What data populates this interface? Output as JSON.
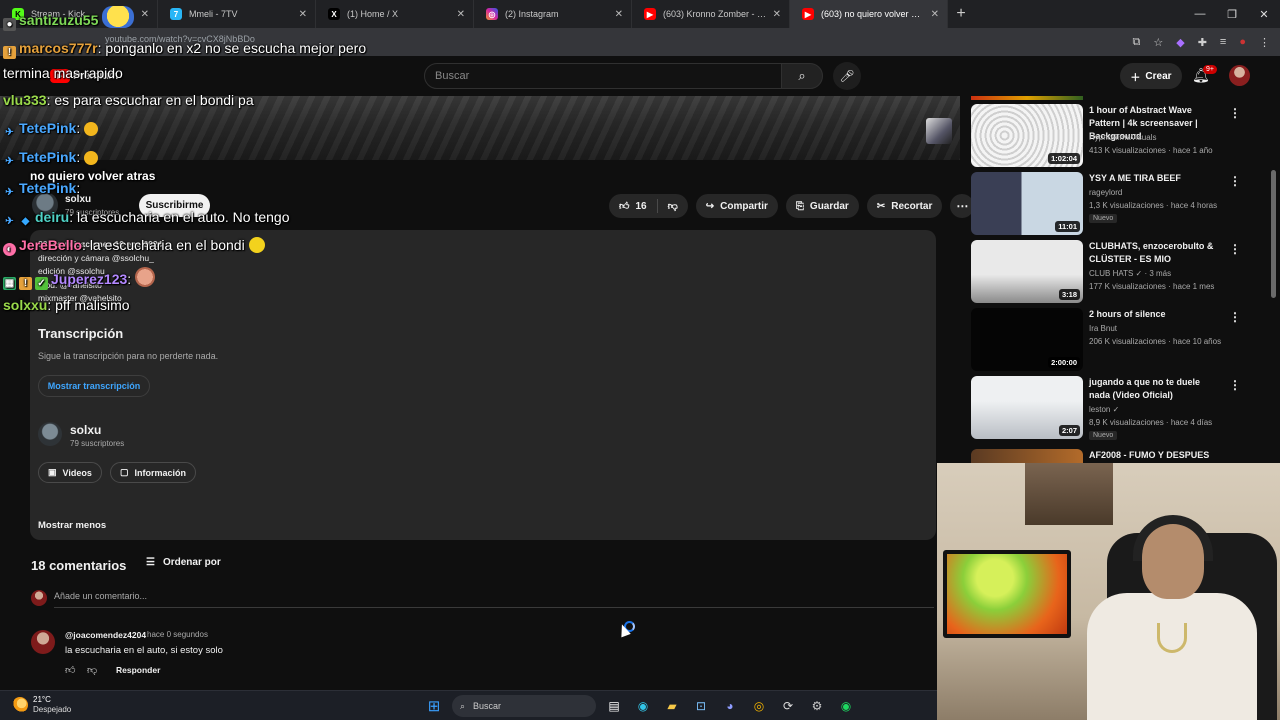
{
  "browser": {
    "tabs": [
      {
        "label": "Stream - Kick",
        "icon": "kick-icon",
        "color": "#53fc18",
        "active": false
      },
      {
        "label": "Mmeli - 7TV",
        "icon": "7tv-icon",
        "color": "#29b6f6",
        "active": false
      },
      {
        "label": "(1) Home / X",
        "icon": "x-icon",
        "color": "#000000",
        "active": false
      },
      {
        "label": "(2) Instagram",
        "icon": "instagram-icon",
        "color": "#d6249f",
        "active": false
      },
      {
        "label": "(603) Kronno Zomber - Chica g",
        "icon": "youtube-icon",
        "color": "#ff0000",
        "active": false
      },
      {
        "label": "(603) no quiero volver atras - Y",
        "icon": "youtube-icon",
        "color": "#ff0000",
        "active": true
      }
    ],
    "url": "youtube.com/watch?v=cvCX8jNbBDo"
  },
  "youtube": {
    "brand": "Premium",
    "search_placeholder": "Buscar",
    "create_label": "Crear",
    "notifications": "9+"
  },
  "video": {
    "title_partial": "no quiero volver atras",
    "channel": "solxu",
    "subscribers_partial": "79 suscriptores",
    "subscribe_label": "Suscribirme",
    "likes": "16",
    "share_label": "Compartir",
    "save_label": "Guardar",
    "clip_label": "Recortar"
  },
  "description": {
    "meta": "82 visualizaciones  10 ene 2024",
    "lines": [
      "dirección y cámara @ssolchu_",
      "edición @ssolchu_",
      "prod. @vanelsito",
      "mixmaster @vahelsito"
    ],
    "transcript_title": "Transcripción",
    "transcript_sub": "Sigue la transcripción para no perderte nada.",
    "transcript_button": "Mostrar transcripción",
    "channel_name": "solxu",
    "channel_subs": "79 suscriptores",
    "videos_button": "Videos",
    "info_button": "Información",
    "show_less": "Mostrar menos"
  },
  "comments": {
    "count": "18 comentarios",
    "sort_label": "Ordenar por",
    "add_placeholder": "Añade un comentario...",
    "items": [
      {
        "author": "@joacomendez4204",
        "time": "hace 0 segundos",
        "text": "la escucharia en el auto, si estoy solo",
        "reply": "Responder"
      }
    ]
  },
  "recommendations": [
    {
      "title": "1 hour of Abstract Wave Pattern | 4k screensaver | Background",
      "channel": "HypnoRimaVisuals",
      "views": "413 K visualizaciones · hace 1 año",
      "duration": "1:02:04",
      "badge": ""
    },
    {
      "title": "YSY A ME TIRA BEEF",
      "channel": "rageylord",
      "views": "1,3 K visualizaciones · hace 4 horas",
      "duration": "11:01",
      "badge": "Nuevo"
    },
    {
      "title": "CLUBHATS, enzocerobulto & CLÜSTER - ES MIO",
      "channel": "CLUB HATS ✓ · 3 más",
      "views": "177 K visualizaciones · hace 1 mes",
      "duration": "3:18",
      "badge": ""
    },
    {
      "title": "2 hours of silence",
      "channel": "Ira Bnut",
      "views": "206 K visualizaciones · hace 10 años",
      "duration": "2:00:00",
      "badge": ""
    },
    {
      "title": "jugando a que no te duele nada (Video Oficial)",
      "channel": "leston ✓",
      "views": "8,9 K visualizaciones · hace 4 días",
      "duration": "2:07",
      "badge": "Nuevo"
    },
    {
      "title": "AF2008 - FUMO Y DESPUES",
      "channel": "",
      "views": "",
      "duration": "",
      "badge": ""
    }
  ],
  "chat": [
    {
      "user": "santizuzu55",
      "text": "",
      "color": "#7ed957"
    },
    {
      "user": "marcos777r",
      "text": ": ponganlo en x2 no se escucha mejor pero",
      "color": "#e6a23c"
    },
    {
      "user": "",
      "text": "termina mas rapido",
      "color": "#ffffff"
    },
    {
      "user": "vlu333",
      "text": ": es para escuchar en el bondi pa",
      "color": "#9ad94b"
    },
    {
      "user": "TetePink",
      "text": ":",
      "color": "#4aa8ff"
    },
    {
      "user": "TetePink",
      "text": ":",
      "color": "#4aa8ff"
    },
    {
      "user": "TetePink",
      "text": ":",
      "color": "#4aa8ff"
    },
    {
      "user": "deiru",
      "text": ": la escucharia en el auto. No tengo",
      "color": "#4fd1c5"
    },
    {
      "user": "JereBello",
      "text": ": la escucharia en el bondi",
      "color": "#ff6fa8"
    },
    {
      "user": "Juperez123",
      "text": ":",
      "color": "#b388ff"
    },
    {
      "user": "solxxu",
      "text": ": pff malisimo",
      "color": "#9ad94b"
    }
  ],
  "taskbar": {
    "temperature": "21°C",
    "weather": "Despejado",
    "search_placeholder": "Buscar"
  }
}
